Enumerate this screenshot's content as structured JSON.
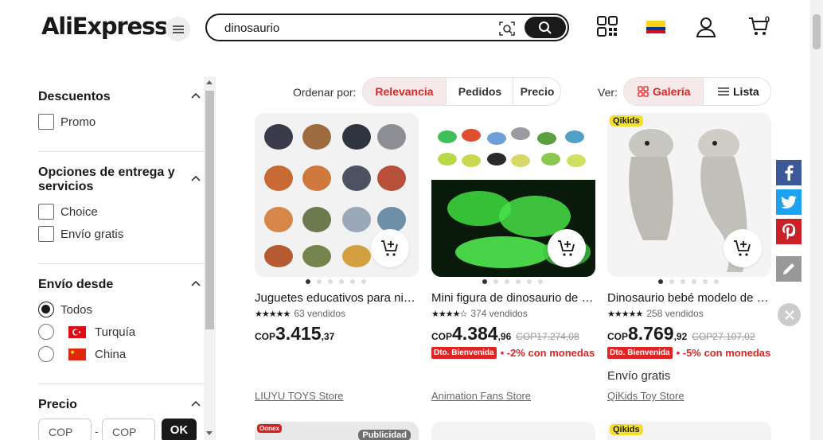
{
  "header": {
    "logo_text": "AliExpress",
    "search_value": "dinosaurio",
    "cart_count": "0",
    "colors": {
      "brand_red": "#e02424",
      "ink": "#191919"
    }
  },
  "filters": {
    "descuentos": {
      "title": "Descuentos",
      "options": [
        "Promo"
      ]
    },
    "entrega": {
      "title": "Opciones de entrega y servicios",
      "options": [
        "Choice",
        "Envío gratis"
      ]
    },
    "envio_desde": {
      "title": "Envío desde",
      "options": [
        "Todos",
        "Turquía",
        "China"
      ],
      "selected": "Todos"
    },
    "precio": {
      "title": "Precio",
      "min_placeholder": "COP",
      "max_placeholder": "COP",
      "separator": "-",
      "ok_label": "OK"
    }
  },
  "sort": {
    "label": "Ordenar por:",
    "options": [
      "Relevancia",
      "Pedidos",
      "Precio"
    ],
    "active": "Relevancia"
  },
  "view": {
    "label": "Ver:",
    "options": [
      "Galería",
      "Lista"
    ],
    "active": "Galería"
  },
  "products": [
    {
      "title": "Juguetes educativos para niños de dinosaurio",
      "sold": "63 vendidos",
      "rating": 5,
      "currency": "COP",
      "price_int": "3.415",
      "price_dec": ",37",
      "old_price": "",
      "promo_tag": "",
      "promo_text": "",
      "shipping": "",
      "store": "LIUYU TOYS Store"
    },
    {
      "title": "Mini figura de dinosaurio de goma brillante",
      "sold": "374 vendidos",
      "rating": 4.5,
      "currency": "COP",
      "price_int": "4.384",
      "price_dec": ",96",
      "old_price": "COP17.274,08",
      "promo_tag": "Dto. Bienvenida",
      "promo_text": "• -2% con monedas",
      "shipping": "",
      "store": "Animation Fans Store"
    },
    {
      "title": "Dinosaurio bebé modelo de simulación",
      "sold": "258 vendidos",
      "rating": 5,
      "currency": "COP",
      "price_int": "8.769",
      "price_dec": ",92",
      "old_price": "COP27.107,02",
      "promo_tag": "Dto. Bienvenida",
      "promo_text": "• -5% con monedas",
      "shipping": "Envío gratis",
      "store": "QiKids Toy Store",
      "badge": "Qikids"
    }
  ],
  "row2": {
    "badge_left": "Oonex",
    "ad_label": "Publicidad",
    "badge_right": "Qikids"
  }
}
